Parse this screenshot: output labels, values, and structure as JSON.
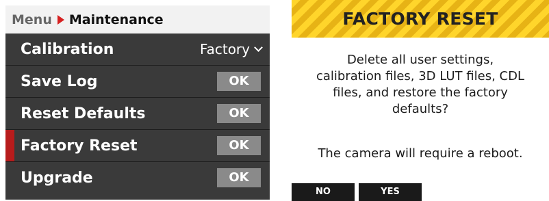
{
  "menu": {
    "breadcrumb": {
      "root": "Menu",
      "current": "Maintenance"
    },
    "items": [
      {
        "label": "Calibration",
        "value": "Factory"
      },
      {
        "label": "Save Log",
        "button": "OK"
      },
      {
        "label": "Reset Defaults",
        "button": "OK"
      },
      {
        "label": "Factory Reset",
        "button": "OK"
      },
      {
        "label": "Upgrade",
        "button": "OK"
      }
    ]
  },
  "dialog": {
    "title": "FACTORY RESET",
    "message_lines": [
      "Delete all user settings,",
      "calibration files, 3D LUT files, CDL",
      "files, and restore the factory",
      "defaults?"
    ],
    "note": "The camera will require a reboot.",
    "buttons": {
      "no": "NO",
      "yes": "YES"
    }
  },
  "colors": {
    "menu_background": "#3a3a3a",
    "selection_indicator": "#b71c1c",
    "breadcrumb_arrow": "#d62020",
    "ok_button": "#8a8a8a",
    "header_stripe_light": "#ffd52b",
    "header_stripe_dark": "#e7b315",
    "dialog_button": "#1a1a1a"
  },
  "icons": {
    "breadcrumb_separator": "arrow-right-icon",
    "calibration_dropdown": "chevron-down-icon"
  }
}
